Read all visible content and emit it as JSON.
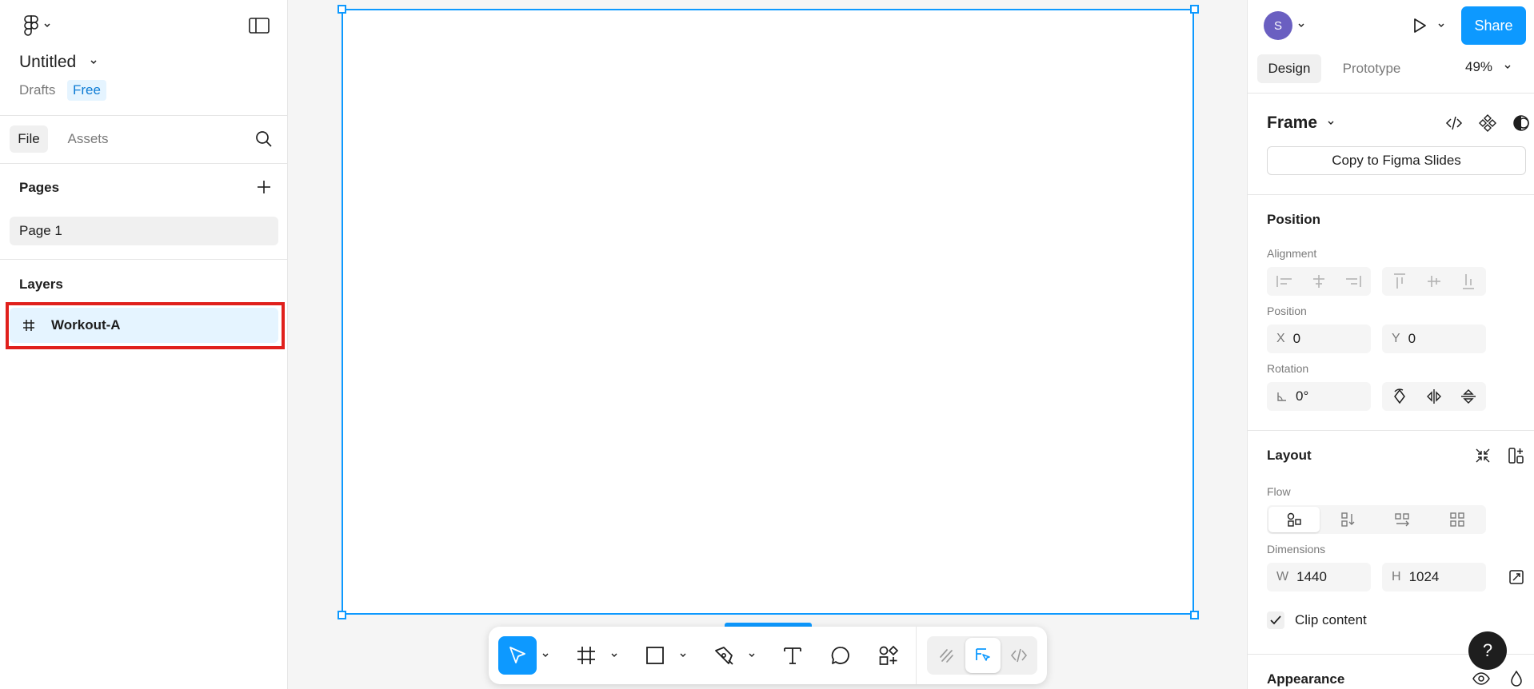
{
  "file": {
    "title": "Untitled",
    "location": "Drafts",
    "plan_badge": "Free"
  },
  "left_tabs": [
    "File",
    "Assets"
  ],
  "pages": {
    "heading": "Pages",
    "items": [
      "Page 1"
    ]
  },
  "layers": {
    "heading": "Layers",
    "items": [
      {
        "name": "Workout-A",
        "icon": "frame-hash-icon",
        "selected": true
      }
    ]
  },
  "right_panel": {
    "avatar_initial": "S",
    "share_label": "Share",
    "tabs": [
      "Design",
      "Prototype"
    ],
    "zoom": "49%",
    "selection_type": "Frame",
    "copy_button": "Copy to Figma Slides",
    "position_section": {
      "title": "Position",
      "alignment_label": "Alignment",
      "position_label": "Position",
      "x_prefix": "X",
      "x_value": "0",
      "y_prefix": "Y",
      "y_value": "0",
      "rotation_label": "Rotation",
      "rotation_value": "0°"
    },
    "layout_section": {
      "title": "Layout",
      "flow_label": "Flow",
      "dimensions_label": "Dimensions",
      "w_prefix": "W",
      "w_value": "1440",
      "h_prefix": "H",
      "h_value": "1024",
      "clip_content_label": "Clip content",
      "clip_content_checked": true
    },
    "appearance_title": "Appearance",
    "help_label": "?"
  },
  "colors": {
    "accent": "#0d99ff",
    "selection_highlight": "#e5f4ff",
    "annotation_red": "#e0201c",
    "avatar": "#6a5fc1"
  }
}
